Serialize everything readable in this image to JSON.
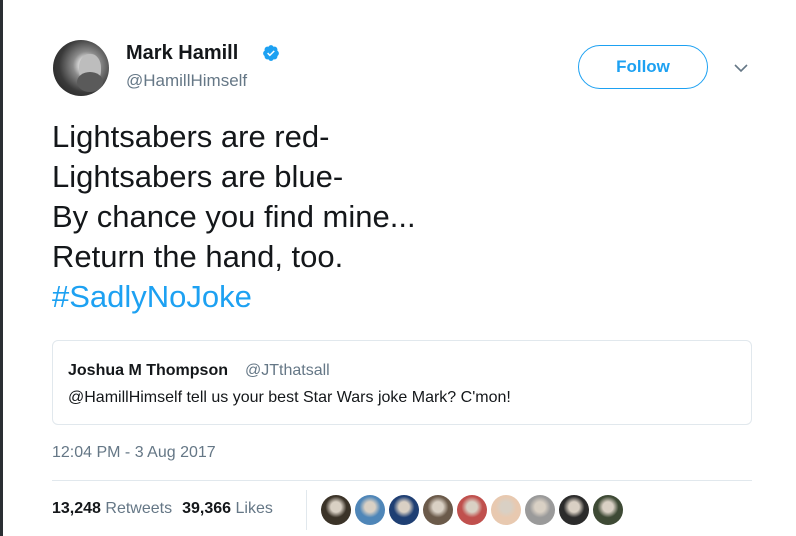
{
  "author": {
    "name": "Mark Hamill",
    "handle": "@HamillHimself",
    "verified_color": "#1da1f2"
  },
  "actions": {
    "follow_label": "Follow",
    "more_icon": "chevron-down-icon"
  },
  "tweet": {
    "lines": [
      "Lightsabers are red-",
      "Lightsabers are blue-",
      "By chance you find mine...",
      "Return the hand, too."
    ],
    "hashtag": "#SadlyNoJoke"
  },
  "quoted_tweet": {
    "name": "Joshua M Thompson",
    "handle": "@JTthatsall",
    "text": "@HamillHimself tell us your best Star Wars joke Mark? C'mon!"
  },
  "timestamp": "12:04 PM - 3 Aug 2017",
  "stats": {
    "retweets_count": "13,248",
    "retweets_label": "Retweets",
    "likes_count": "39,366",
    "likes_label": "Likes"
  },
  "likers": [
    {
      "name": "liker-avatar-1",
      "color": "#3b3328"
    },
    {
      "name": "liker-avatar-2",
      "color": "#4f86b8"
    },
    {
      "name": "liker-avatar-3",
      "color": "#1f3f73"
    },
    {
      "name": "liker-avatar-4",
      "color": "#6b5a4a"
    },
    {
      "name": "liker-avatar-5",
      "color": "#c0504d"
    },
    {
      "name": "liker-avatar-6",
      "color": "#e8c9b0"
    },
    {
      "name": "liker-avatar-7",
      "color": "#9a9a9a"
    },
    {
      "name": "liker-avatar-8",
      "color": "#2b2b2b"
    },
    {
      "name": "liker-avatar-9",
      "color": "#3e4a35"
    }
  ]
}
